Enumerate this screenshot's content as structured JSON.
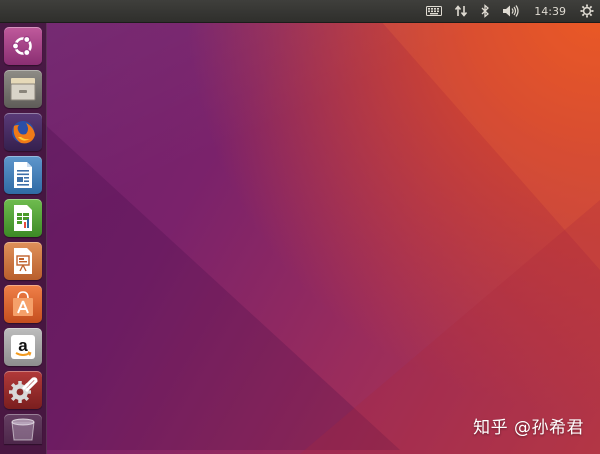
{
  "panel": {
    "clock": "14:39",
    "indicators": [
      "keyboard-icon",
      "network-icon",
      "bluetooth-icon",
      "volume-icon",
      "power-gear-icon"
    ]
  },
  "launcher": {
    "items": [
      {
        "name": "dash-home",
        "icon": "ubuntu-logo-icon"
      },
      {
        "name": "files",
        "icon": "file-cabinet-icon"
      },
      {
        "name": "firefox",
        "icon": "firefox-icon"
      },
      {
        "name": "libreoffice-writer",
        "icon": "writer-document-icon"
      },
      {
        "name": "libreoffice-calc",
        "icon": "calc-spreadsheet-icon"
      },
      {
        "name": "libreoffice-impress",
        "icon": "impress-presentation-icon"
      },
      {
        "name": "ubuntu-software",
        "icon": "shopping-bag-icon"
      },
      {
        "name": "amazon",
        "icon": "amazon-icon",
        "glyph": "a"
      },
      {
        "name": "system-settings",
        "icon": "settings-wrench-gear-icon"
      },
      {
        "name": "trash",
        "icon": "trash-icon"
      }
    ]
  },
  "watermark": "知乎 @孙希君",
  "colors": {
    "panel_bg": "#333331",
    "desktop_purple": "#6b1f6b",
    "desktop_orange": "#e8541f"
  }
}
